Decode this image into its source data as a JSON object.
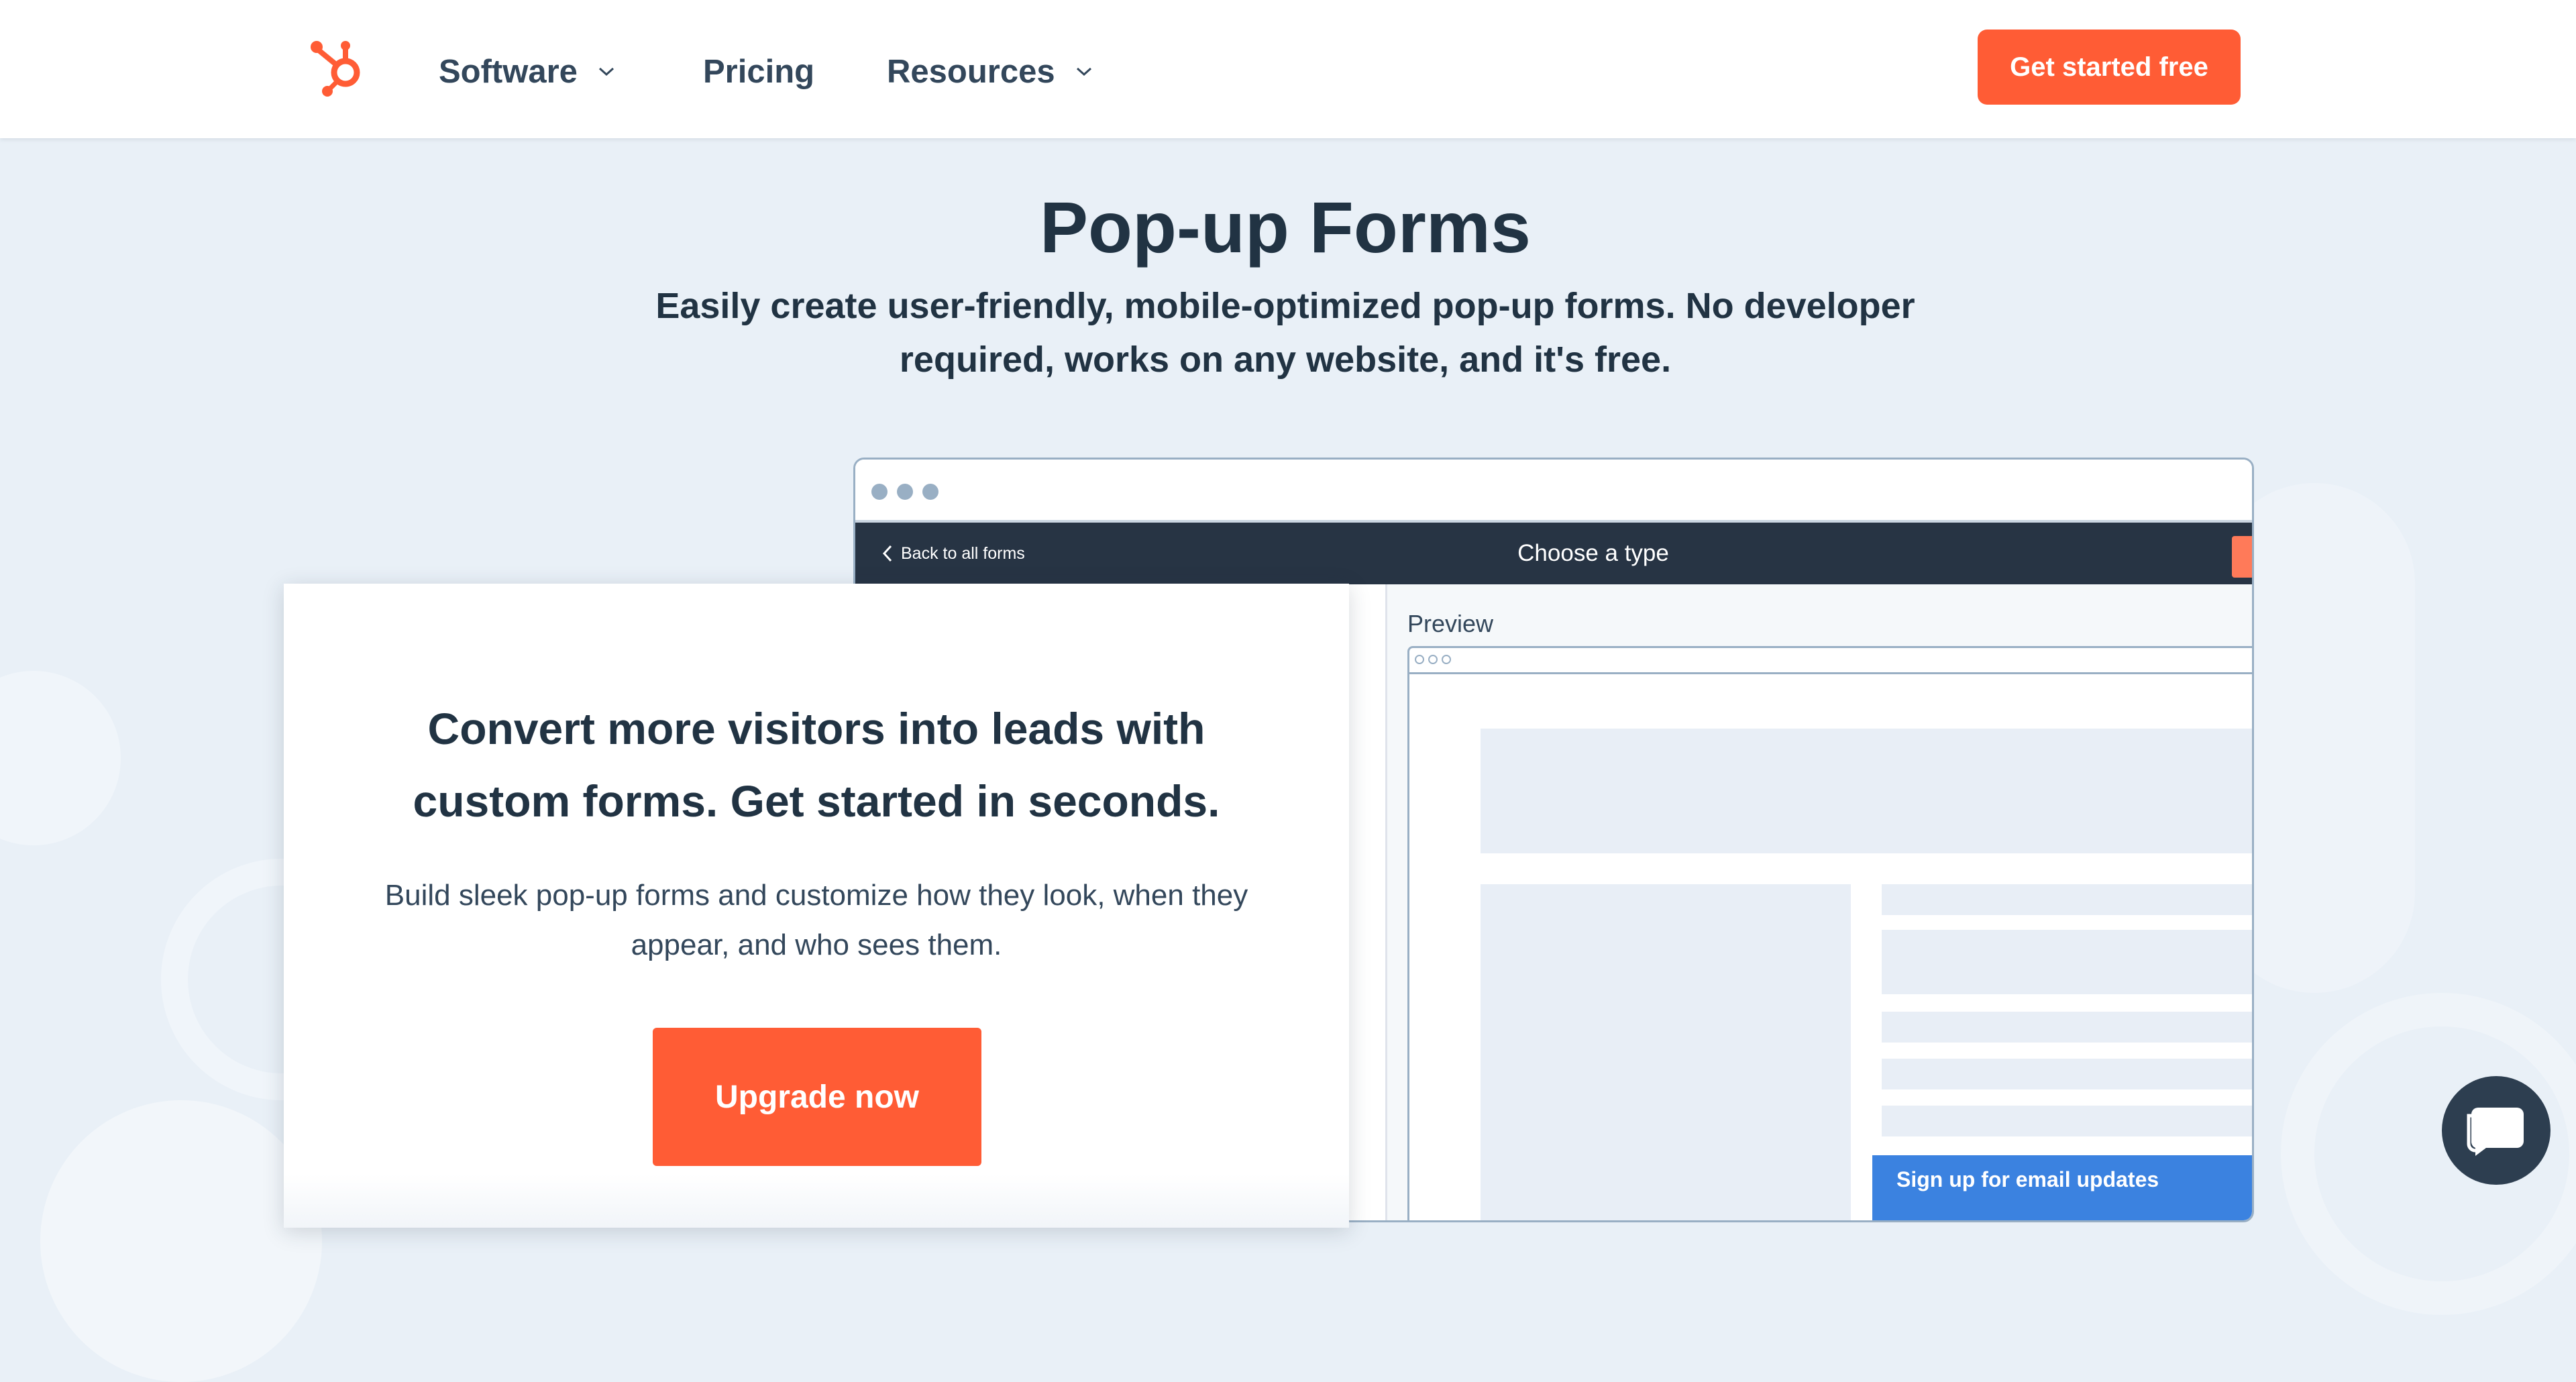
{
  "nav": {
    "items": [
      {
        "label": "Software",
        "has_dropdown": true
      },
      {
        "label": "Pricing",
        "has_dropdown": false
      },
      {
        "label": "Resources",
        "has_dropdown": true
      }
    ],
    "cta_label": "Get started free"
  },
  "hero": {
    "title": "Pop-up Forms",
    "subtitle_line1": "Easily create user-friendly, mobile-optimized pop-up forms. No developer",
    "subtitle_line2": "required, works on any website, and it's free."
  },
  "mockup": {
    "back_link": "Back to all forms",
    "app_title": "Choose a type",
    "preview_label": "Preview",
    "popup_text": "Sign up for email updates"
  },
  "card": {
    "title_line1": "Convert more visitors into leads with",
    "title_line2": "custom forms. Get started in seconds.",
    "text_line1": "Build sleek pop-up forms and customize how they look, when they",
    "text_line2": "appear, and who sees them.",
    "button_label": "Upgrade now"
  },
  "colors": {
    "brand_orange": "#ff5c35",
    "navy": "#213343",
    "background": "#e9f0f7",
    "popup_blue": "#3b82e0"
  },
  "icons": {
    "logo": "hubspot-sprocket-icon",
    "chevron": "chevron-down-icon",
    "back": "chevron-left-icon",
    "chat": "chat-bubble-icon"
  }
}
